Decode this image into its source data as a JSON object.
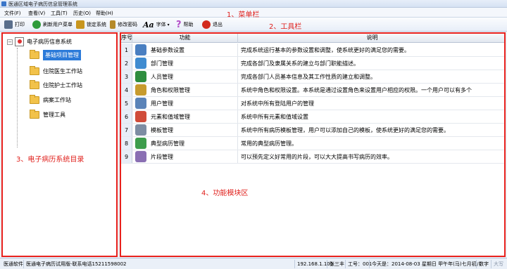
{
  "window": {
    "title": "医通区域电子病历信息管理系统"
  },
  "menu": [
    {
      "label": "文件(F)"
    },
    {
      "label": "查看(V)"
    },
    {
      "label": "工具(T)"
    },
    {
      "label": "历史(O)"
    },
    {
      "label": "帮助(H)"
    }
  ],
  "toolbar": {
    "buttons": [
      {
        "label": "打印",
        "icon": "printer-icon",
        "color": "#5a6f8c"
      },
      {
        "label": "刷新用户菜单",
        "icon": "refresh-icon",
        "color": "#2f9b3a"
      },
      {
        "label": "锁定系统",
        "icon": "lock-icon",
        "color": "#c8961e"
      },
      {
        "label": "修改密码",
        "icon": "key-icon",
        "color": "#b58a2a"
      },
      {
        "label": "字体",
        "icon": "font-icon",
        "glyph": "Aa"
      },
      {
        "label": "帮助",
        "icon": "help-icon",
        "glyph": "?"
      },
      {
        "label": "退出",
        "icon": "power-icon",
        "color": "#d22a1e"
      }
    ]
  },
  "annotations": {
    "menubar": "1、菜单栏",
    "toolbar": "2、工具栏",
    "directory": "3、电子病历系统目录",
    "modules": "4、功能模块区"
  },
  "tree": {
    "root": "电子病历信息系统",
    "items": [
      {
        "label": "基础项目管理",
        "selected": true
      },
      {
        "label": "住院医生工作站"
      },
      {
        "label": "住院护士工作站"
      },
      {
        "label": "病案工作站"
      },
      {
        "label": "管理工具"
      }
    ]
  },
  "grid": {
    "headers": [
      "序号",
      "功能",
      "说明"
    ],
    "rows": [
      {
        "no": "1",
        "func": "基础参数设置",
        "desc": "完成系统运行基本的参数设置和调整，使系统更好的满足您的需要。",
        "icon_color": "#4a7fc1"
      },
      {
        "no": "2",
        "func": "部门管理",
        "desc": "完成各部门及隶属关系的建立与部门职能描述。",
        "icon_color": "#3f8bd0"
      },
      {
        "no": "3",
        "func": "人员管理",
        "desc": "完成各部门人员基本信息及其工作性质的建立和调整。",
        "icon_color": "#2e8d3e"
      },
      {
        "no": "4",
        "func": "角色和权限管理",
        "desc": "系统中角色和权限设置。本系统是通过设置角色来设置用户相应的权限。一个用户可以有多个",
        "icon_color": "#c79b2e"
      },
      {
        "no": "5",
        "func": "用户管理",
        "desc": "对系统中所有登陆用户的管理",
        "icon_color": "#5a83b8"
      },
      {
        "no": "6",
        "func": "元素和值域管理",
        "desc": "系统中所有元素和值域设置",
        "icon_color": "#d04c3a"
      },
      {
        "no": "7",
        "func": "模板管理",
        "desc": "系统中所有病历模板管理，用户可以添加自己的模板，使系统更好的满足您的需要。",
        "icon_color": "#7d8da3"
      },
      {
        "no": "8",
        "func": "典型病历管理",
        "desc": "常用的典型病历管理。",
        "icon_color": "#3d9d4c"
      },
      {
        "no": "9",
        "func": "片段管理",
        "desc": "可以预先定义好常用的片段，可以大大提高书写病历的效率。",
        "icon_color": "#8a6fb3"
      }
    ]
  },
  "status": {
    "app": "医通软件",
    "product": "医通电子病历试用版-联系电话15211598002",
    "ip": "192.168.1.105",
    "user": "张三丰",
    "work_no": "工号：001",
    "date": "今天是：2014-08-03 星期日 甲午年(马)七月初八",
    "numlock": "数字",
    "capslock": "大写"
  }
}
